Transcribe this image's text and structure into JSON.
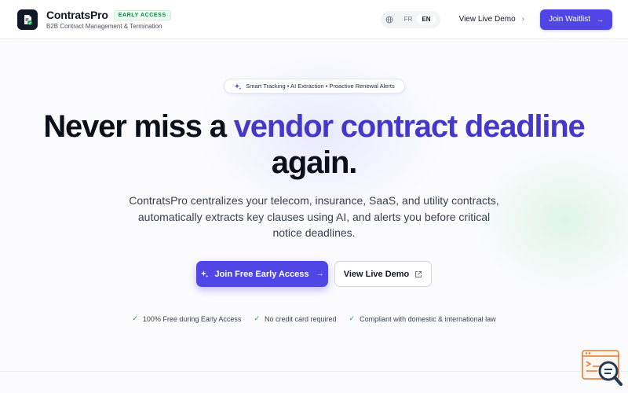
{
  "header": {
    "brand_name": "ContratsPro",
    "badge": "EARLY ACCESS",
    "tagline": "B2B Contract Management & Termination",
    "languages": [
      "FR",
      "EN"
    ],
    "active_language": "EN",
    "demo_link": "View Live Demo",
    "waitlist_button": "Join Waitlist"
  },
  "hero": {
    "pill": "Smart Tracking • AI Extraction • Proactive Renewal Alerts",
    "title_part1": "Never miss a ",
    "title_accent": "vendor contract deadline",
    "title_part2": " again",
    "title_period": ".",
    "description": "ContratsPro centralizes your telecom, insurance, SaaS, and utility contracts, automatically extracts key clauses using AI, and alerts you before critical notice deadlines.",
    "cta_primary": "Join Free Early Access",
    "cta_secondary": "View Live Demo"
  },
  "features": [
    "100% Free during Early Access",
    "No credit card required",
    "Compliant with domestic & international law"
  ],
  "colors": {
    "accent": "#4f46e5",
    "accent_text": "#4338ca",
    "success": "#16a34a",
    "widget_orange": "#e8762b"
  },
  "icons": {
    "logo": "document-check-icon",
    "language": "globe-icon",
    "pill": "sparkles-icon",
    "external": "external-link-icon",
    "corner": "search-analytics-icon"
  }
}
